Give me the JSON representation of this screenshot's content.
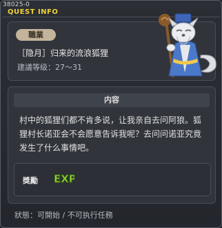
{
  "window": {
    "id": "38025-0",
    "title": "QUEST INFO"
  },
  "quest": {
    "job_label": "職業",
    "name": "［隐月］归来的流浪狐狸",
    "level": "建議等级：27～31"
  },
  "content": {
    "header": "内容",
    "description": "村中的狐狸们都不肯多说，让我亲自去问阿狼。狐狸村长诺亚会不会愿意告诉我呢？去问问诺亚究竟发生了什么事情吧。"
  },
  "reward": {
    "label": "獎勵",
    "exp_icon_text": "EXP"
  },
  "status": {
    "text": "狀態：可開始 / 不可执行任務"
  },
  "colors": {
    "title_accent": "#f0d236",
    "job_pill": "#c3b49b",
    "exp_green": "#9be23a"
  }
}
